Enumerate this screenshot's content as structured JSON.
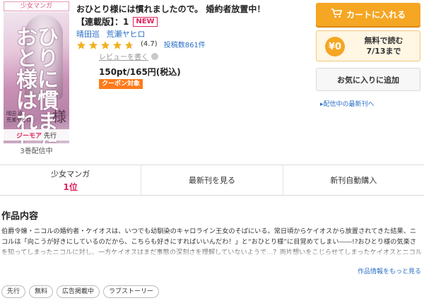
{
  "cover": {
    "genre_tag": "少女マンガ",
    "title_art": "おひとり様には慣れました",
    "art_sama": "様",
    "art_authors": "晴田 巡\n荒瀬ヤヒロ",
    "label_logo": "ジーモア",
    "label_text": "先行",
    "volumes_label": "3巻配信中"
  },
  "product": {
    "title": "おひとり様には慣れましたので。 婚約者放置中！",
    "edition": "【連載版】：1",
    "new_badge": "NEW",
    "authors": [
      "晴田巡",
      "荒瀬ヤヒロ"
    ],
    "rating": 4.7,
    "rating_text": "(4.7)",
    "review_count_text": "投稿数861件",
    "review_write": "レビューを書く",
    "price": "150pt/165円(税込)",
    "coupon": "クーポン対象"
  },
  "actions": {
    "cart_label": "カートに入れる",
    "free_circle": "¥0",
    "free_line1": "無料で読む",
    "free_line2": "7/13まで",
    "favorite_label": "お気に入りに追加",
    "latest_link": "▸配信中の最新刊へ"
  },
  "tabs": {
    "genre_label": "少女マンガ",
    "genre_rank": "1位",
    "latest_label": "最新刊を見る",
    "auto_buy_label": "新刊自動購入"
  },
  "description": {
    "heading": "作品内容",
    "text": "伯爵令嬢・ニコルの婚約者・ケイオスは、いつでも幼馴染のキャロライン王女のそばにいる。常日頃からケイオスから放置されてきた結果、ニコルは「向こうが好きにしているのだから、こちらも好きにすればいいんだわ！」と“おひとり様”に目覚めてしまい――!?おひとり様の気楽さを知ってしまったニコルに対し、一方ケイオスはまだ事態の深刻さを理解していないようで…？両片想いをこじらせてしまったケイオスとニコルのドタバタすれ違いラブコメディ、待望のコミカライズ！　【本商品は単話コンテンツとなります。単行本版と収録内容が異なる場合がございます】",
    "more_link": "作品情報をもっと見る"
  },
  "tags": [
    "先行",
    "無料",
    "広告掲載中",
    "ラブストーリー"
  ],
  "colors": {
    "accent_orange": "#f5a623",
    "link_blue": "#2a6fc6",
    "rank_pink": "#e0245e",
    "star_gold": "#f2b01e"
  }
}
